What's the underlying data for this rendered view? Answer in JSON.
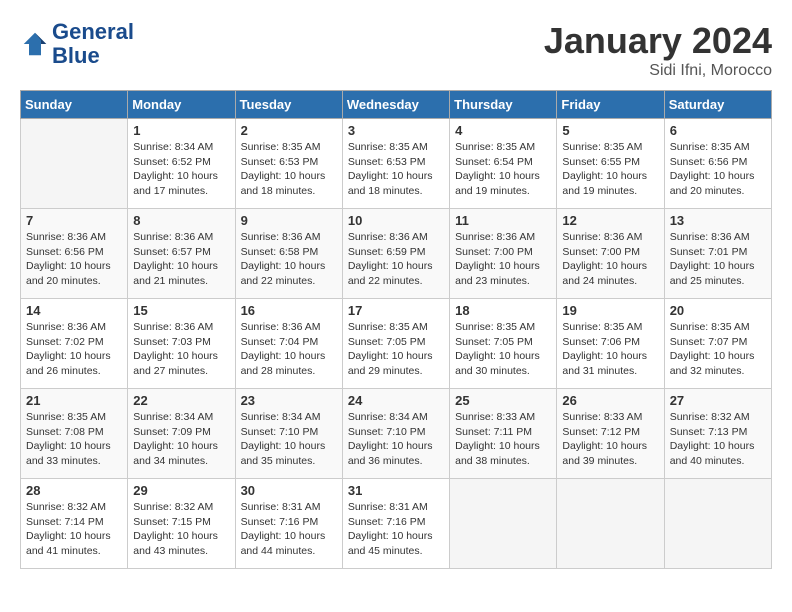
{
  "header": {
    "logo_line1": "General",
    "logo_line2": "Blue",
    "month": "January 2024",
    "location": "Sidi Ifni, Morocco"
  },
  "weekdays": [
    "Sunday",
    "Monday",
    "Tuesday",
    "Wednesday",
    "Thursday",
    "Friday",
    "Saturday"
  ],
  "weeks": [
    [
      {
        "day": "",
        "detail": ""
      },
      {
        "day": "1",
        "detail": "Sunrise: 8:34 AM\nSunset: 6:52 PM\nDaylight: 10 hours\nand 17 minutes."
      },
      {
        "day": "2",
        "detail": "Sunrise: 8:35 AM\nSunset: 6:53 PM\nDaylight: 10 hours\nand 18 minutes."
      },
      {
        "day": "3",
        "detail": "Sunrise: 8:35 AM\nSunset: 6:53 PM\nDaylight: 10 hours\nand 18 minutes."
      },
      {
        "day": "4",
        "detail": "Sunrise: 8:35 AM\nSunset: 6:54 PM\nDaylight: 10 hours\nand 19 minutes."
      },
      {
        "day": "5",
        "detail": "Sunrise: 8:35 AM\nSunset: 6:55 PM\nDaylight: 10 hours\nand 19 minutes."
      },
      {
        "day": "6",
        "detail": "Sunrise: 8:35 AM\nSunset: 6:56 PM\nDaylight: 10 hours\nand 20 minutes."
      }
    ],
    [
      {
        "day": "7",
        "detail": "Sunrise: 8:36 AM\nSunset: 6:56 PM\nDaylight: 10 hours\nand 20 minutes."
      },
      {
        "day": "8",
        "detail": "Sunrise: 8:36 AM\nSunset: 6:57 PM\nDaylight: 10 hours\nand 21 minutes."
      },
      {
        "day": "9",
        "detail": "Sunrise: 8:36 AM\nSunset: 6:58 PM\nDaylight: 10 hours\nand 22 minutes."
      },
      {
        "day": "10",
        "detail": "Sunrise: 8:36 AM\nSunset: 6:59 PM\nDaylight: 10 hours\nand 22 minutes."
      },
      {
        "day": "11",
        "detail": "Sunrise: 8:36 AM\nSunset: 7:00 PM\nDaylight: 10 hours\nand 23 minutes."
      },
      {
        "day": "12",
        "detail": "Sunrise: 8:36 AM\nSunset: 7:00 PM\nDaylight: 10 hours\nand 24 minutes."
      },
      {
        "day": "13",
        "detail": "Sunrise: 8:36 AM\nSunset: 7:01 PM\nDaylight: 10 hours\nand 25 minutes."
      }
    ],
    [
      {
        "day": "14",
        "detail": "Sunrise: 8:36 AM\nSunset: 7:02 PM\nDaylight: 10 hours\nand 26 minutes."
      },
      {
        "day": "15",
        "detail": "Sunrise: 8:36 AM\nSunset: 7:03 PM\nDaylight: 10 hours\nand 27 minutes."
      },
      {
        "day": "16",
        "detail": "Sunrise: 8:36 AM\nSunset: 7:04 PM\nDaylight: 10 hours\nand 28 minutes."
      },
      {
        "day": "17",
        "detail": "Sunrise: 8:35 AM\nSunset: 7:05 PM\nDaylight: 10 hours\nand 29 minutes."
      },
      {
        "day": "18",
        "detail": "Sunrise: 8:35 AM\nSunset: 7:05 PM\nDaylight: 10 hours\nand 30 minutes."
      },
      {
        "day": "19",
        "detail": "Sunrise: 8:35 AM\nSunset: 7:06 PM\nDaylight: 10 hours\nand 31 minutes."
      },
      {
        "day": "20",
        "detail": "Sunrise: 8:35 AM\nSunset: 7:07 PM\nDaylight: 10 hours\nand 32 minutes."
      }
    ],
    [
      {
        "day": "21",
        "detail": "Sunrise: 8:35 AM\nSunset: 7:08 PM\nDaylight: 10 hours\nand 33 minutes."
      },
      {
        "day": "22",
        "detail": "Sunrise: 8:34 AM\nSunset: 7:09 PM\nDaylight: 10 hours\nand 34 minutes."
      },
      {
        "day": "23",
        "detail": "Sunrise: 8:34 AM\nSunset: 7:10 PM\nDaylight: 10 hours\nand 35 minutes."
      },
      {
        "day": "24",
        "detail": "Sunrise: 8:34 AM\nSunset: 7:10 PM\nDaylight: 10 hours\nand 36 minutes."
      },
      {
        "day": "25",
        "detail": "Sunrise: 8:33 AM\nSunset: 7:11 PM\nDaylight: 10 hours\nand 38 minutes."
      },
      {
        "day": "26",
        "detail": "Sunrise: 8:33 AM\nSunset: 7:12 PM\nDaylight: 10 hours\nand 39 minutes."
      },
      {
        "day": "27",
        "detail": "Sunrise: 8:32 AM\nSunset: 7:13 PM\nDaylight: 10 hours\nand 40 minutes."
      }
    ],
    [
      {
        "day": "28",
        "detail": "Sunrise: 8:32 AM\nSunset: 7:14 PM\nDaylight: 10 hours\nand 41 minutes."
      },
      {
        "day": "29",
        "detail": "Sunrise: 8:32 AM\nSunset: 7:15 PM\nDaylight: 10 hours\nand 43 minutes."
      },
      {
        "day": "30",
        "detail": "Sunrise: 8:31 AM\nSunset: 7:16 PM\nDaylight: 10 hours\nand 44 minutes."
      },
      {
        "day": "31",
        "detail": "Sunrise: 8:31 AM\nSunset: 7:16 PM\nDaylight: 10 hours\nand 45 minutes."
      },
      {
        "day": "",
        "detail": ""
      },
      {
        "day": "",
        "detail": ""
      },
      {
        "day": "",
        "detail": ""
      }
    ]
  ]
}
